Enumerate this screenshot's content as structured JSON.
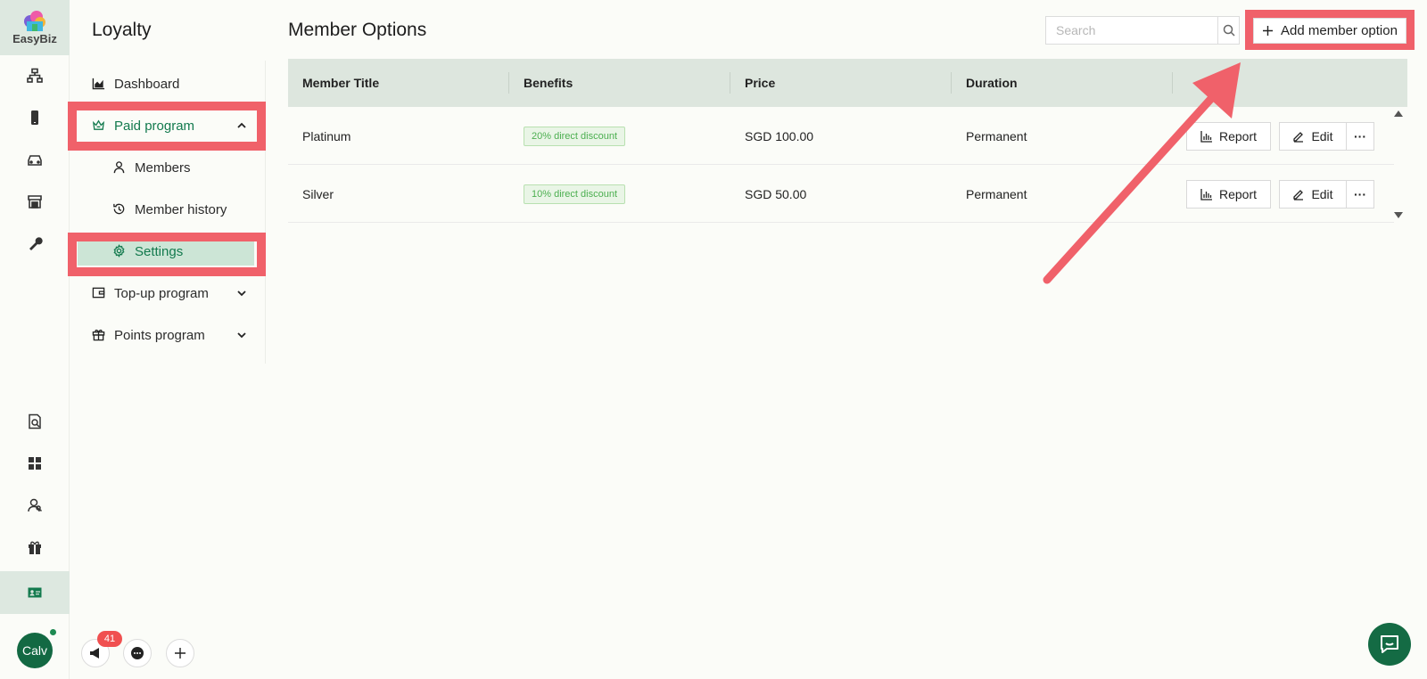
{
  "app": {
    "logo_text": "EasyBiz",
    "accent": "#137a4e",
    "highlight": "#f0616a"
  },
  "rail": {
    "top_icons": [
      "org-chart-icon",
      "phone-icon",
      "car-icon",
      "store-icon",
      "wrench-icon"
    ],
    "bottom_icons": [
      "report-search-icon",
      "grid-icon",
      "users-icon",
      "gift-icon",
      "member-card-icon"
    ],
    "active_icon": "member-card-icon"
  },
  "subnav": {
    "title": "Loyalty",
    "items": [
      {
        "label": "Dashboard",
        "icon": "chart-icon"
      },
      {
        "label": "Paid program",
        "icon": "crown-icon",
        "expanded": true
      },
      {
        "label": "Members",
        "icon": "user-icon"
      },
      {
        "label": "Member history",
        "icon": "history-icon"
      },
      {
        "label": "Settings",
        "icon": "gear-icon",
        "active": true
      },
      {
        "label": "Top-up program",
        "icon": "wallet-icon"
      },
      {
        "label": "Points program",
        "icon": "gift-icon"
      }
    ]
  },
  "main": {
    "title": "Member Options",
    "search": {
      "placeholder": "Search",
      "value": ""
    },
    "add_button": "Add member option",
    "table": {
      "columns": [
        "Member Title",
        "Benefits",
        "Price",
        "Duration"
      ],
      "rows": [
        {
          "title": "Platinum",
          "benefit": "20% direct discount",
          "price": "SGD 100.00",
          "duration": "Permanent"
        },
        {
          "title": "Silver",
          "benefit": "10% direct discount",
          "price": "SGD 50.00",
          "duration": "Permanent"
        }
      ],
      "row_actions": {
        "report": "Report",
        "edit": "Edit",
        "more": "···"
      }
    }
  },
  "footer": {
    "avatar_text": "Calv",
    "notification_count": "41"
  }
}
